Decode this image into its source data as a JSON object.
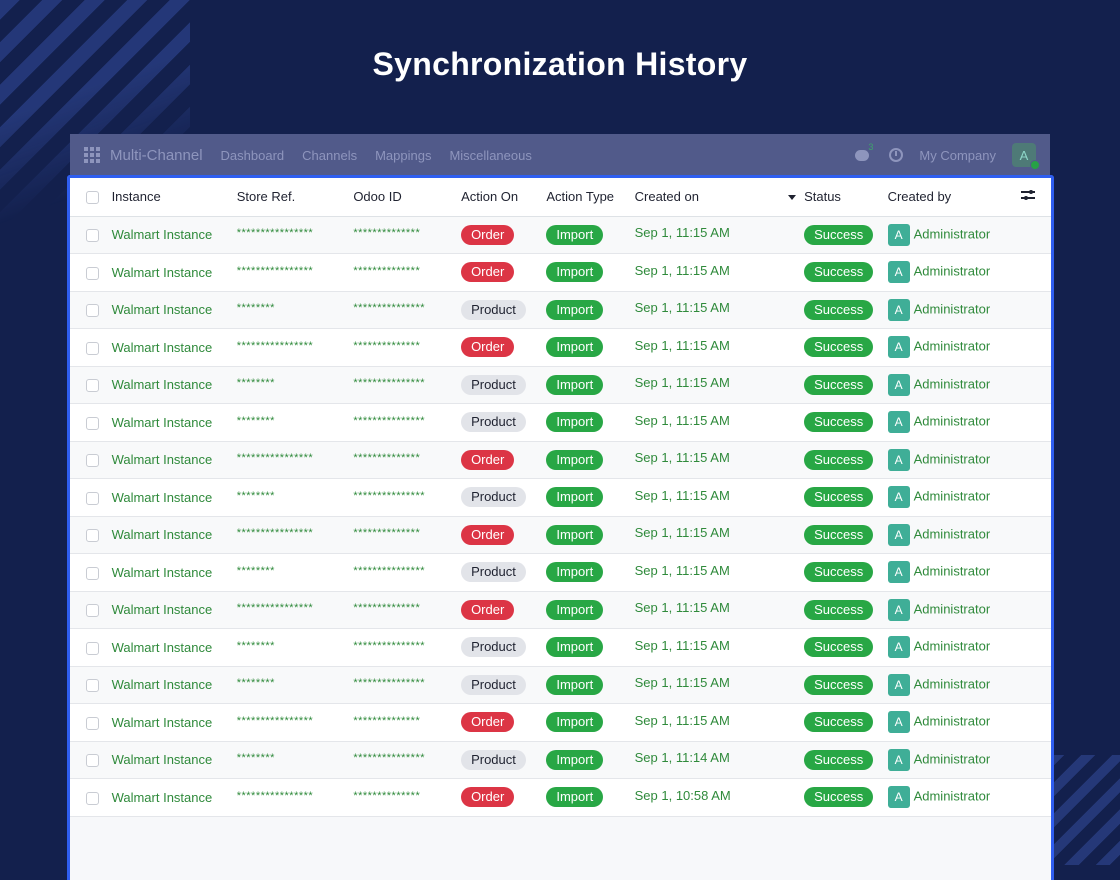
{
  "page": {
    "title": "Synchronization History"
  },
  "navbar": {
    "app_name": "Multi-Channel",
    "links": [
      "Dashboard",
      "Channels",
      "Mappings",
      "Miscellaneous"
    ],
    "chat_count": "3",
    "company": "My Company",
    "avatar_letter": "A"
  },
  "table": {
    "headers": {
      "instance": "Instance",
      "store_ref": "Store Ref.",
      "odoo_id": "Odoo ID",
      "action_on": "Action On",
      "action_type": "Action Type",
      "created_on": "Created on",
      "status": "Status",
      "created_by": "Created by"
    },
    "rows": [
      {
        "instance": "Walmart Instance",
        "store_ref": "****************",
        "odoo_id": "**************",
        "action_on": "Order",
        "action_type": "Import",
        "created_on": "Sep 1, 11:15 AM",
        "status": "Success",
        "avatar": "A",
        "created_by": "Administrator"
      },
      {
        "instance": "Walmart Instance",
        "store_ref": "****************",
        "odoo_id": "**************",
        "action_on": "Order",
        "action_type": "Import",
        "created_on": "Sep 1, 11:15 AM",
        "status": "Success",
        "avatar": "A",
        "created_by": "Administrator"
      },
      {
        "instance": "Walmart Instance",
        "store_ref": "********",
        "odoo_id": "***************",
        "action_on": "Product",
        "action_type": "Import",
        "created_on": "Sep 1, 11:15 AM",
        "status": "Success",
        "avatar": "A",
        "created_by": "Administrator"
      },
      {
        "instance": "Walmart Instance",
        "store_ref": "****************",
        "odoo_id": "**************",
        "action_on": "Order",
        "action_type": "Import",
        "created_on": "Sep 1, 11:15 AM",
        "status": "Success",
        "avatar": "A",
        "created_by": "Administrator"
      },
      {
        "instance": "Walmart Instance",
        "store_ref": "********",
        "odoo_id": "***************",
        "action_on": "Product",
        "action_type": "Import",
        "created_on": "Sep 1, 11:15 AM",
        "status": "Success",
        "avatar": "A",
        "created_by": "Administrator"
      },
      {
        "instance": "Walmart Instance",
        "store_ref": "********",
        "odoo_id": "***************",
        "action_on": "Product",
        "action_type": "Import",
        "created_on": "Sep 1, 11:15 AM",
        "status": "Success",
        "avatar": "A",
        "created_by": "Administrator"
      },
      {
        "instance": "Walmart Instance",
        "store_ref": "****************",
        "odoo_id": "**************",
        "action_on": "Order",
        "action_type": "Import",
        "created_on": "Sep 1, 11:15 AM",
        "status": "Success",
        "avatar": "A",
        "created_by": "Administrator"
      },
      {
        "instance": "Walmart Instance",
        "store_ref": "********",
        "odoo_id": "***************",
        "action_on": "Product",
        "action_type": "Import",
        "created_on": "Sep 1, 11:15 AM",
        "status": "Success",
        "avatar": "A",
        "created_by": "Administrator"
      },
      {
        "instance": "Walmart Instance",
        "store_ref": "****************",
        "odoo_id": "**************",
        "action_on": "Order",
        "action_type": "Import",
        "created_on": "Sep 1, 11:15 AM",
        "status": "Success",
        "avatar": "A",
        "created_by": "Administrator"
      },
      {
        "instance": "Walmart Instance",
        "store_ref": "********",
        "odoo_id": "***************",
        "action_on": "Product",
        "action_type": "Import",
        "created_on": "Sep 1, 11:15 AM",
        "status": "Success",
        "avatar": "A",
        "created_by": "Administrator"
      },
      {
        "instance": "Walmart Instance",
        "store_ref": "****************",
        "odoo_id": "**************",
        "action_on": "Order",
        "action_type": "Import",
        "created_on": "Sep 1, 11:15 AM",
        "status": "Success",
        "avatar": "A",
        "created_by": "Administrator"
      },
      {
        "instance": "Walmart Instance",
        "store_ref": "********",
        "odoo_id": "***************",
        "action_on": "Product",
        "action_type": "Import",
        "created_on": "Sep 1, 11:15 AM",
        "status": "Success",
        "avatar": "A",
        "created_by": "Administrator"
      },
      {
        "instance": "Walmart Instance",
        "store_ref": "********",
        "odoo_id": "***************",
        "action_on": "Product",
        "action_type": "Import",
        "created_on": "Sep 1, 11:15 AM",
        "status": "Success",
        "avatar": "A",
        "created_by": "Administrator"
      },
      {
        "instance": "Walmart Instance",
        "store_ref": "****************",
        "odoo_id": "**************",
        "action_on": "Order",
        "action_type": "Import",
        "created_on": "Sep 1, 11:15 AM",
        "status": "Success",
        "avatar": "A",
        "created_by": "Administrator"
      },
      {
        "instance": "Walmart Instance",
        "store_ref": "********",
        "odoo_id": "***************",
        "action_on": "Product",
        "action_type": "Import",
        "created_on": "Sep 1, 11:14 AM",
        "status": "Success",
        "avatar": "A",
        "created_by": "Administrator"
      },
      {
        "instance": "Walmart Instance",
        "store_ref": "****************",
        "odoo_id": "**************",
        "action_on": "Order",
        "action_type": "Import",
        "created_on": "Sep 1, 10:58 AM",
        "status": "Success",
        "avatar": "A",
        "created_by": "Administrator"
      }
    ]
  },
  "colors": {
    "background": "#13204d",
    "link_green": "#2f8a3b",
    "order_red": "#dc3545",
    "success_green": "#28a745",
    "panel_border": "#2f5ef0"
  }
}
